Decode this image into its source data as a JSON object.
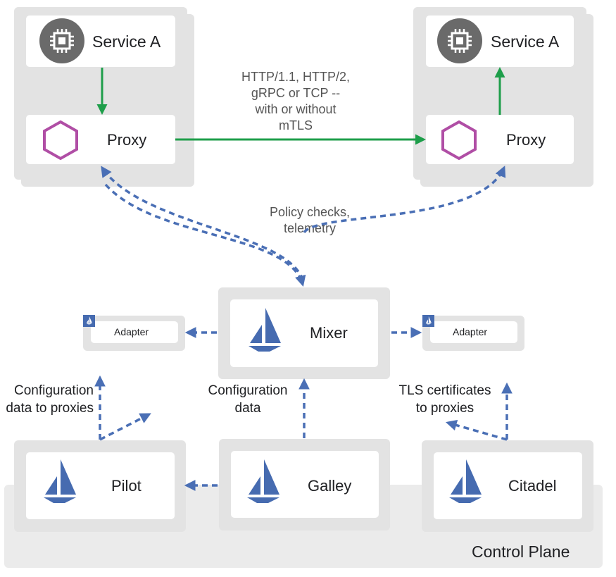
{
  "colors": {
    "green_arrow": "#1e9e4a",
    "blue_dashed": "#4a6fb5",
    "hexagon": "#b04ea5",
    "chip_circle": "#6a6a6a",
    "istio_blue": "#466bb0"
  },
  "data_plane": {
    "left": {
      "service": {
        "label": "Service A",
        "icon": "chip-icon"
      },
      "proxy": {
        "label": "Proxy",
        "icon": "hexagon-icon"
      }
    },
    "right": {
      "service": {
        "label": "Service A",
        "icon": "chip-icon"
      },
      "proxy": {
        "label": "Proxy",
        "icon": "hexagon-icon"
      }
    },
    "protocol_note": [
      "HTTP/1.1, HTTP/2,",
      "gRPC or TCP --",
      "with or without",
      "mTLS"
    ]
  },
  "policy_note": [
    "Policy checks,",
    "telemetry"
  ],
  "mixer": {
    "label": "Mixer",
    "icon": "istio-sail-icon"
  },
  "adapters": [
    {
      "label": "Adapter",
      "icon": "istio-sail-icon"
    },
    {
      "label": "Adapter",
      "icon": "istio-sail-icon"
    }
  ],
  "notes": {
    "pilot": [
      "Configuration",
      "data to proxies"
    ],
    "galley": [
      "Configuration",
      "data"
    ],
    "citadel": [
      "TLS certificates",
      "to proxies"
    ]
  },
  "control_plane": {
    "label": "Control Plane",
    "components": [
      {
        "label": "Pilot",
        "icon": "istio-sail-icon"
      },
      {
        "label": "Galley",
        "icon": "istio-sail-icon"
      },
      {
        "label": "Citadel",
        "icon": "istio-sail-icon"
      }
    ]
  }
}
